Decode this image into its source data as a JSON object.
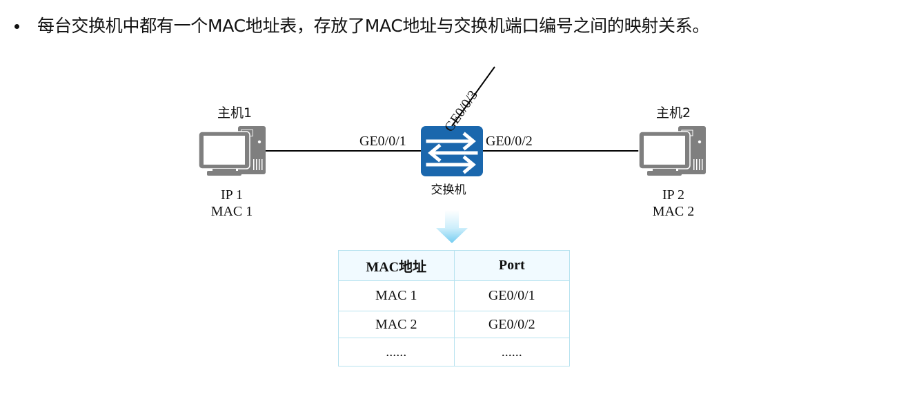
{
  "bullet": {
    "text": "每台交换机中都有一个MAC地址表，存放了MAC地址与交换机端口编号之间的映射关系。"
  },
  "diagram": {
    "host1": {
      "name": "主机1",
      "ip": "IP 1",
      "mac": "MAC 1",
      "icon": "desktop-computer-icon"
    },
    "host2": {
      "name": "主机2",
      "ip": "IP 2",
      "mac": "MAC 2",
      "icon": "desktop-computer-icon"
    },
    "switch": {
      "label": "交换机",
      "icon": "switch-icon",
      "color": "#1a67ad"
    },
    "ports": {
      "p1": "GE0/0/1",
      "p2": "GE0/0/2",
      "p3": "GE0/0/3"
    },
    "arrow": {
      "icon": "down-arrow-icon",
      "color": "#7fd1f2"
    },
    "colors": {
      "host": "#7f7f7f",
      "link": "#000000",
      "table_border": "#b6e2ef",
      "table_header_bg": "#f1faff"
    }
  },
  "mac_table": {
    "headers": [
      "MAC地址",
      "Port"
    ],
    "rows": [
      [
        "MAC 1",
        "GE0/0/1"
      ],
      [
        "MAC 2",
        "GE0/0/2"
      ],
      [
        "......",
        "......"
      ]
    ]
  }
}
